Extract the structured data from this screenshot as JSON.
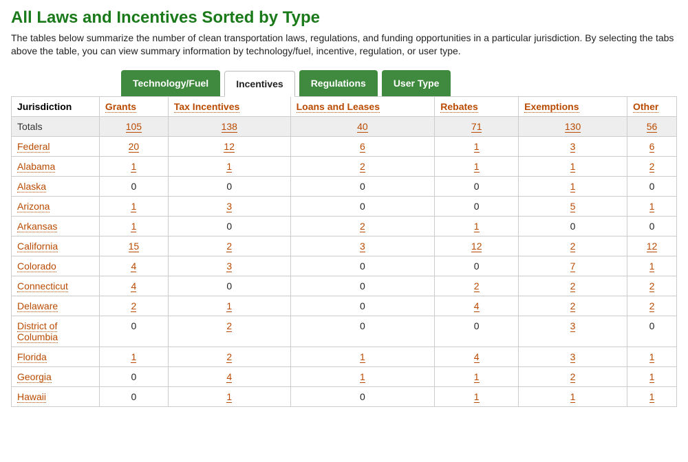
{
  "title": "All Laws and Incentives Sorted by Type",
  "intro": "The tables below summarize the number of clean transportation laws, regulations, and funding opportunities in a particular jurisdiction. By selecting the tabs above the table, you can view summary information by technology/fuel, incentive, regulation, or user type.",
  "tabs": [
    {
      "label": "Technology/Fuel",
      "active": false
    },
    {
      "label": "Incentives",
      "active": true
    },
    {
      "label": "Regulations",
      "active": false
    },
    {
      "label": "User Type",
      "active": false
    }
  ],
  "table": {
    "jur_header": "Jurisdiction",
    "columns": [
      "Grants",
      "Tax Incentives",
      "Loans and Leases",
      "Rebates",
      "Exemptions",
      "Other"
    ],
    "totals_label": "Totals",
    "totals": [
      105,
      138,
      40,
      71,
      130,
      56
    ],
    "rows": [
      {
        "j": "Federal",
        "v": [
          20,
          12,
          6,
          1,
          3,
          6
        ]
      },
      {
        "j": "Alabama",
        "v": [
          1,
          1,
          2,
          1,
          1,
          2
        ]
      },
      {
        "j": "Alaska",
        "v": [
          0,
          0,
          0,
          0,
          1,
          0
        ]
      },
      {
        "j": "Arizona",
        "v": [
          1,
          3,
          0,
          0,
          5,
          1
        ]
      },
      {
        "j": "Arkansas",
        "v": [
          1,
          0,
          2,
          1,
          0,
          0
        ]
      },
      {
        "j": "California",
        "v": [
          15,
          2,
          3,
          12,
          2,
          12
        ]
      },
      {
        "j": "Colorado",
        "v": [
          4,
          3,
          0,
          0,
          7,
          1
        ]
      },
      {
        "j": "Connecticut",
        "v": [
          4,
          0,
          0,
          2,
          2,
          2
        ]
      },
      {
        "j": "Delaware",
        "v": [
          2,
          1,
          0,
          4,
          2,
          2
        ]
      },
      {
        "j": "District of Columbia",
        "v": [
          0,
          2,
          0,
          0,
          3,
          0
        ]
      },
      {
        "j": "Florida",
        "v": [
          1,
          2,
          1,
          4,
          3,
          1
        ]
      },
      {
        "j": "Georgia",
        "v": [
          0,
          4,
          1,
          1,
          2,
          1
        ]
      },
      {
        "j": "Hawaii",
        "v": [
          0,
          1,
          0,
          1,
          1,
          1
        ]
      }
    ]
  }
}
